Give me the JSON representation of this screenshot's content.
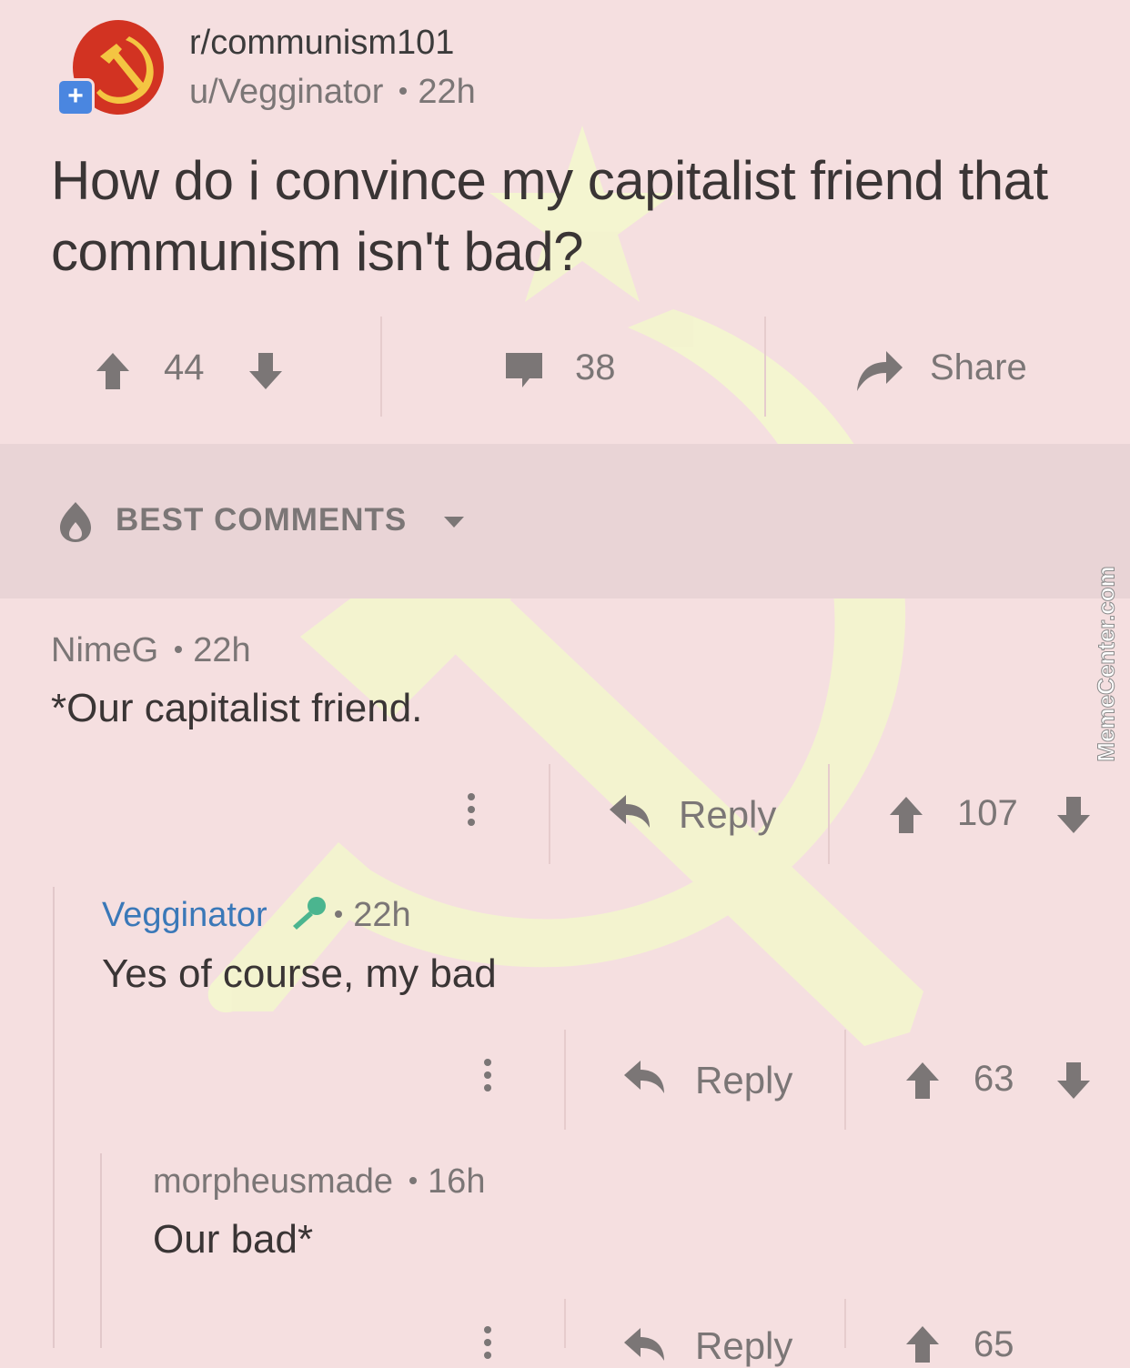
{
  "post": {
    "subreddit": "r/communism101",
    "author": "u/Vegginator",
    "age": "22h",
    "title": "How do i convince my capitalist friend that communism isn't bad?",
    "upvotes": "44",
    "comments": "38",
    "share_label": "Share"
  },
  "sort": {
    "label": "BEST COMMENTS"
  },
  "comments": [
    {
      "author": "NimeG",
      "age": "22h",
      "body": "*Our capitalist friend.",
      "reply_label": "Reply",
      "score": "107"
    },
    {
      "author": "Vegginator",
      "age": "22h",
      "body": "Yes of course, my bad",
      "reply_label": "Reply",
      "score": "63"
    },
    {
      "author": "morpheusmade",
      "age": "16h",
      "body": "Our bad*",
      "reply_label": "Reply",
      "score": "65"
    }
  ],
  "watermark": "MemeCenter.com",
  "colors": {
    "background": "#f5dfe0",
    "emblem": "#f3f5cf",
    "avatar": "#d23322",
    "op_name": "#3a78b8",
    "op_badge": "#4bb58f"
  },
  "icons": [
    "hammer-sickle-icon",
    "plus-icon",
    "upvote-icon",
    "downvote-icon",
    "comment-icon",
    "share-icon",
    "flame-icon",
    "caret-down-icon",
    "kebab-icon",
    "reply-icon",
    "mic-icon"
  ]
}
